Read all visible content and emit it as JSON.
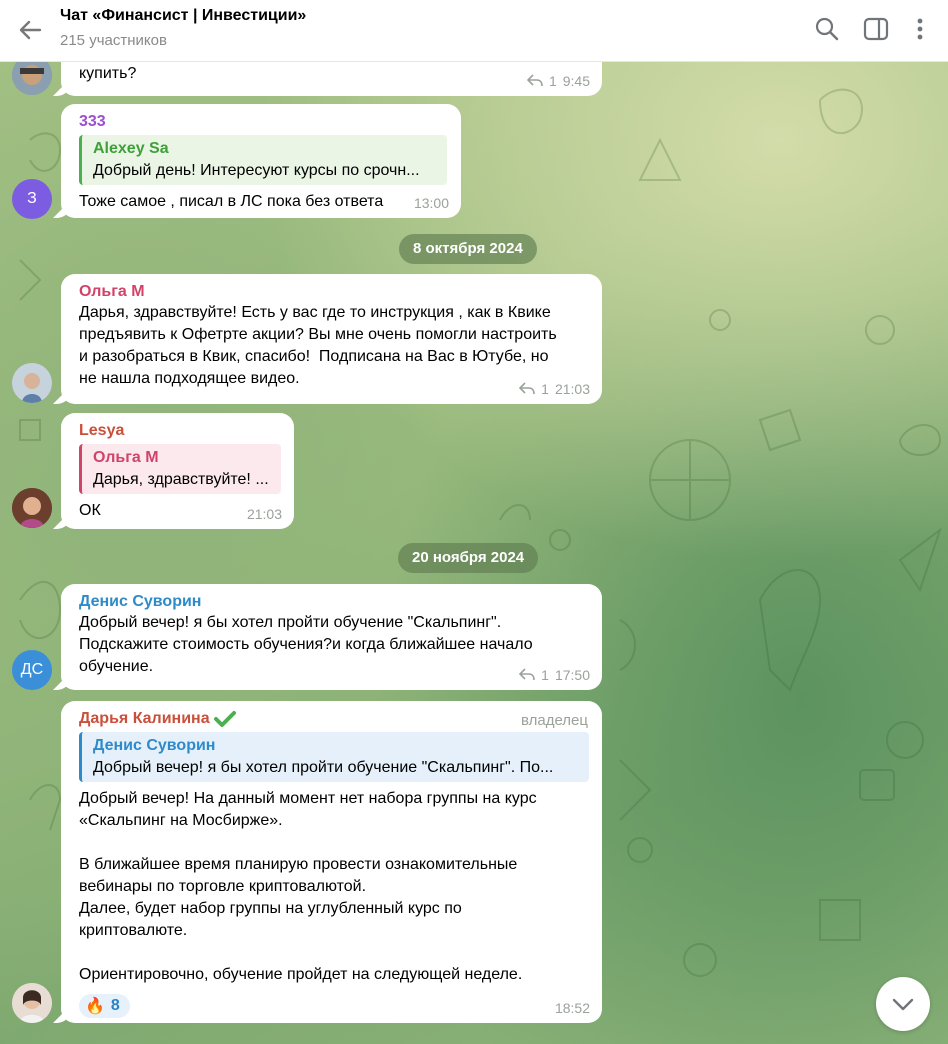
{
  "header": {
    "title": "Чат «Финансист | Инвестиции»",
    "subtitle": "215 участников"
  },
  "messages": [
    {
      "id": "m0",
      "text": "купить?",
      "reply_count": "1",
      "time": "9:45"
    },
    {
      "id": "m1",
      "author": "333",
      "author_color": "#9c4fd0",
      "avatar_initials": "З",
      "avatar_color": "#7c5ce0",
      "quote_author": "Alexey Sa",
      "quote_text": "Добрый день! Интересуют курсы по срочн...",
      "text": "Тоже самое , писал в ЛС пока без ответа",
      "time": "13:00"
    },
    {
      "id": "m2",
      "author": "Ольга М",
      "author_color": "#d1446a",
      "text": "Дарья, здравствуйте! Есть у вас где то инструкция , как в Квике\nпредъявить к Офетрте акции? Вы мне очень помогли настроить\nи разобраться в Квик, спасибо!  Подписана на Вас в Ютубе, но\nне нашла подходящее видео.",
      "reply_count": "1",
      "time": "21:03"
    },
    {
      "id": "m3",
      "author": "Lesya",
      "author_color": "#c9503a",
      "quote_author": "Ольга М",
      "quote_text": "Дарья, здравствуйте! ...",
      "text": "ОК",
      "time": "21:03"
    },
    {
      "id": "m4",
      "author": "Денис Суворин",
      "author_color": "#2d8bc9",
      "avatar_initials": "ДС",
      "avatar_color": "#3b8fd9",
      "text": "Добрый вечер! я бы хотел пройти обучение \"Скальпинг\".\nПодскажите стоимость обучения?и когда ближайшее начало\nобучение.",
      "reply_count": "1",
      "time": "17:50"
    },
    {
      "id": "m5",
      "author": "Дарья Калинина",
      "author_color": "#c9503a",
      "owner_label": "владелец",
      "quote_author": "Денис Суворин",
      "quote_text": "Добрый вечер! я бы хотел пройти обучение \"Скальпинг\". По...",
      "text": "Добрый вечер! На данный момент нет набора группы на курс\n«Скальпинг на Мосбирже».\n\nВ ближайшее время планирую провести ознакомительные\nвебинары по торговле криптовалютой.\nДалее, будет набор группы на углубленный курс по\nкриптовалюте.\n\nОриентировочно, обучение пройдет на следующей неделе.",
      "reaction_emoji": "🔥",
      "reaction_count": "8",
      "time": "18:52"
    }
  ],
  "dates": {
    "d1": "8 октября 2024",
    "d2": "20 ноября 2024"
  }
}
